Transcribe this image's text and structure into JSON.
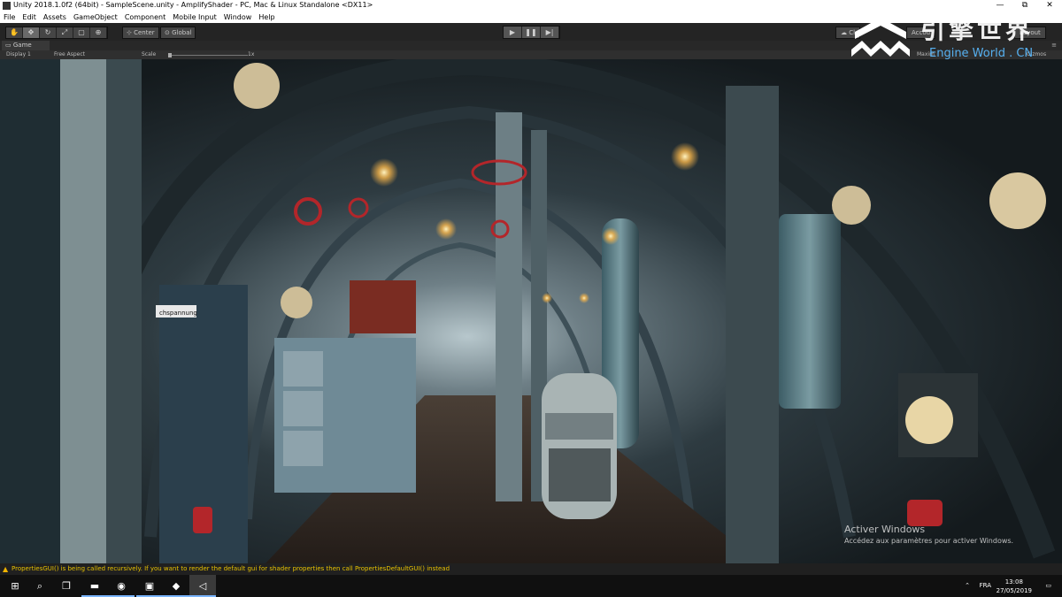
{
  "window": {
    "title": "Unity 2018.1.0f2 (64bit) - SampleScene.unity - AmplifyShader - PC, Mac & Linux Standalone <DX11>",
    "minimize": "—",
    "maximize": "⧉",
    "close": "✕"
  },
  "menu": [
    "File",
    "Edit",
    "Assets",
    "GameObject",
    "Component",
    "Mobile Input",
    "Window",
    "Help"
  ],
  "toolbar": {
    "pivot_label": "Center",
    "space_label": "Global",
    "collab_label": "Cl",
    "account_label": "Accou",
    "layers_label": "Layers",
    "layout_label": "Layout"
  },
  "game_view": {
    "tab_label": "Game",
    "display_label": "Display 1",
    "aspect_label": "Free Aspect",
    "scale_label": "Scale",
    "scale_value": "1x",
    "maximize_label": "Maxim",
    "stats_label": "Stats",
    "gizmos_label": "Gizmos"
  },
  "watermark": {
    "cn_text": "引擎世界",
    "en_text": "Engine World . CN"
  },
  "viewport": {
    "panel_label": "chspannung",
    "activate_title": "Activer Windows",
    "activate_sub": "Accédez aux paramètres pour activer Windows."
  },
  "status": {
    "message": "PropertiesGUI() is being called recursively. If you want to render the default gui for shader properties then call PropertiesDefaultGUI() instead"
  },
  "taskbar": {
    "language": "FRA",
    "time": "13:08",
    "date": "27/05/2019"
  },
  "colors": {
    "status_warning": "#e8c200",
    "watermark_blue": "#56b0f0",
    "valve_red": "#b3262a"
  }
}
